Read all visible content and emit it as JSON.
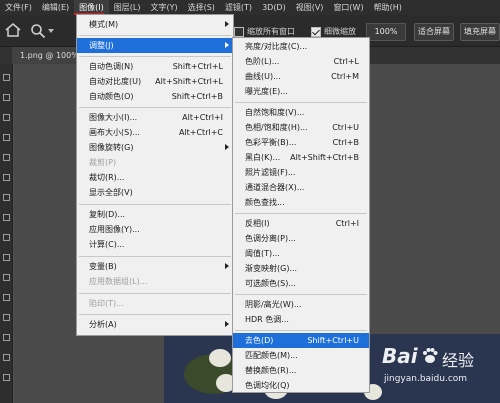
{
  "menubar": {
    "items": [
      "文件(F)",
      "编辑(E)",
      "图像(I)",
      "图层(L)",
      "文字(Y)",
      "选择(S)",
      "滤镜(T)",
      "3D(D)",
      "视图(V)",
      "窗口(W)",
      "帮助(H)"
    ],
    "active_index": 2
  },
  "options": {
    "checkbox1_label": "缩放所有窗口",
    "checkbox2_label": "细微缩放",
    "zoom_value": "100%",
    "fit_screen": "适合屏幕",
    "fill_screen": "填充屏幕"
  },
  "document": {
    "tab_label": "1.png @ 100%"
  },
  "image_menu": {
    "items": [
      {
        "label": "模式(M)",
        "shortcut": "",
        "submenu": true,
        "disabled": false
      },
      {
        "label": "调整(J)",
        "shortcut": "",
        "submenu": true,
        "disabled": false,
        "highlight": true
      },
      {
        "label": "自动色调(N)",
        "shortcut": "Shift+Ctrl+L",
        "submenu": false,
        "disabled": false
      },
      {
        "label": "自动对比度(U)",
        "shortcut": "Alt+Shift+Ctrl+L",
        "submenu": false,
        "disabled": false
      },
      {
        "label": "自动颜色(O)",
        "shortcut": "Shift+Ctrl+B",
        "submenu": false,
        "disabled": false
      },
      {
        "label": "图像大小(I)...",
        "shortcut": "Alt+Ctrl+I",
        "submenu": false,
        "disabled": false
      },
      {
        "label": "画布大小(S)...",
        "shortcut": "Alt+Ctrl+C",
        "submenu": false,
        "disabled": false
      },
      {
        "label": "图像旋转(G)",
        "shortcut": "",
        "submenu": true,
        "disabled": false
      },
      {
        "label": "裁剪(P)",
        "shortcut": "",
        "submenu": false,
        "disabled": true
      },
      {
        "label": "裁切(R)...",
        "shortcut": "",
        "submenu": false,
        "disabled": false
      },
      {
        "label": "显示全部(V)",
        "shortcut": "",
        "submenu": false,
        "disabled": false
      },
      {
        "label": "复制(D)...",
        "shortcut": "",
        "submenu": false,
        "disabled": false
      },
      {
        "label": "应用图像(Y)...",
        "shortcut": "",
        "submenu": false,
        "disabled": false
      },
      {
        "label": "计算(C)...",
        "shortcut": "",
        "submenu": false,
        "disabled": false
      },
      {
        "label": "变量(B)",
        "shortcut": "",
        "submenu": true,
        "disabled": false
      },
      {
        "label": "应用数据组(L)...",
        "shortcut": "",
        "submenu": false,
        "disabled": true
      },
      {
        "label": "陷印(T)...",
        "shortcut": "",
        "submenu": false,
        "disabled": true
      },
      {
        "label": "分析(A)",
        "shortcut": "",
        "submenu": true,
        "disabled": false
      }
    ]
  },
  "adjust_menu": {
    "items": [
      {
        "label": "亮度/对比度(C)...",
        "shortcut": ""
      },
      {
        "label": "色阶(L)...",
        "shortcut": "Ctrl+L"
      },
      {
        "label": "曲线(U)...",
        "shortcut": "Ctrl+M"
      },
      {
        "label": "曝光度(E)...",
        "shortcut": ""
      },
      {
        "label": "自然饱和度(V)...",
        "shortcut": ""
      },
      {
        "label": "色相/饱和度(H)...",
        "shortcut": "Ctrl+U"
      },
      {
        "label": "色彩平衡(B)...",
        "shortcut": "Ctrl+B"
      },
      {
        "label": "黑白(K)...",
        "shortcut": "Alt+Shift+Ctrl+B"
      },
      {
        "label": "照片滤镜(F)...",
        "shortcut": ""
      },
      {
        "label": "通道混合器(X)...",
        "shortcut": ""
      },
      {
        "label": "颜色查找...",
        "shortcut": ""
      },
      {
        "label": "反相(I)",
        "shortcut": "Ctrl+I"
      },
      {
        "label": "色调分离(P)...",
        "shortcut": ""
      },
      {
        "label": "阈值(T)...",
        "shortcut": ""
      },
      {
        "label": "渐变映射(G)...",
        "shortcut": ""
      },
      {
        "label": "可选颜色(S)...",
        "shortcut": ""
      },
      {
        "label": "阴影/高光(W)...",
        "shortcut": ""
      },
      {
        "label": "HDR 色调...",
        "shortcut": ""
      },
      {
        "label": "去色(D)",
        "shortcut": "Shift+Ctrl+U",
        "highlight": true
      },
      {
        "label": "匹配颜色(M)...",
        "shortcut": ""
      },
      {
        "label": "替换颜色(R)...",
        "shortcut": ""
      },
      {
        "label": "色调均化(Q)",
        "shortcut": ""
      }
    ]
  },
  "watermark": {
    "brand": "Bai",
    "brand2": "经验",
    "url": "jingyan.baidu.com"
  }
}
